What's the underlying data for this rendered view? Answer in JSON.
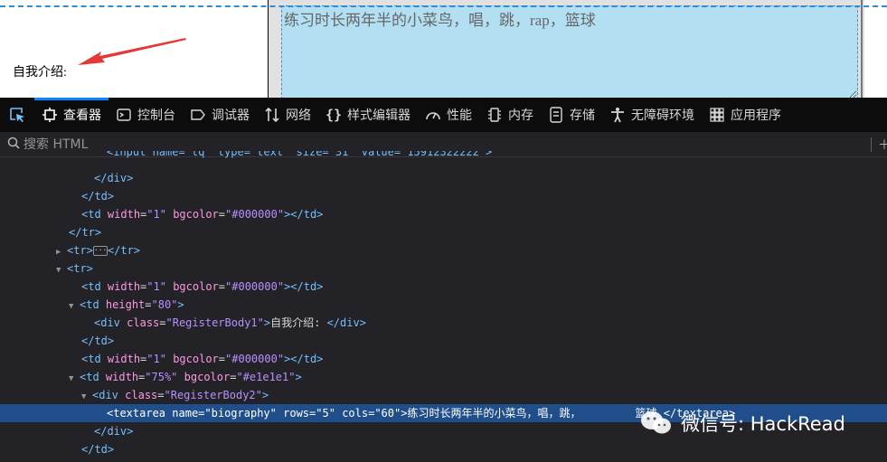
{
  "viewport": {
    "label": "自我介绍:",
    "textarea_value": "练习时长两年半的小菜鸟，唱，跳，rap，篮球"
  },
  "toolbar": {
    "tabs": [
      {
        "label": "查看器",
        "icon": "inspector-icon"
      },
      {
        "label": "控制台",
        "icon": "console-icon"
      },
      {
        "label": "调试器",
        "icon": "debugger-icon"
      },
      {
        "label": "网络",
        "icon": "network-icon"
      },
      {
        "label": "样式编辑器",
        "icon": "style-editor-icon"
      },
      {
        "label": "性能",
        "icon": "performance-icon"
      },
      {
        "label": "内存",
        "icon": "memory-icon"
      },
      {
        "label": "存储",
        "icon": "storage-icon"
      },
      {
        "label": "无障碍环境",
        "icon": "accessibility-icon"
      },
      {
        "label": "应用程序",
        "icon": "application-icon"
      }
    ],
    "active_tab": "查看器"
  },
  "search": {
    "placeholder": "搜索 HTML"
  },
  "tree": {
    "line0": "<input name=\"tq\" type=\"text\" size=\"31\" value=\"15912322222\">",
    "l1_close": "</div>",
    "l2_close": "</td>",
    "l3": {
      "open": "<td",
      "a1": "width",
      "v1": "\"1\"",
      "a2": "bgcolor",
      "v2": "\"#000000\"",
      "close": "></td>"
    },
    "l4_close": "</tr>",
    "l5": {
      "open": "<tr>",
      "close": "</tr>",
      "ellipsis": "···"
    },
    "l6_open": "<tr>",
    "l7": {
      "open": "<td",
      "a1": "width",
      "v1": "\"1\"",
      "a2": "bgcolor",
      "v2": "\"#000000\"",
      "close": "></td>"
    },
    "l8": {
      "open": "<td",
      "a1": "height",
      "v1": "\"80\"",
      "close": ">"
    },
    "l9": {
      "open": "<div",
      "a1": "class",
      "v1": "\"RegisterBody1\"",
      "gt": ">",
      "text": "自我介绍:",
      "close": "</div>"
    },
    "l10_close": "</td>",
    "l11": {
      "open": "<td",
      "a1": "width",
      "v1": "\"1\"",
      "a2": "bgcolor",
      "v2": "\"#000000\"",
      "close": "></td>"
    },
    "l12": {
      "open": "<td",
      "a1": "width",
      "v1": "\"75%\"",
      "a2": "bgcolor",
      "v2": "\"#e1e1e1\"",
      "close": ">"
    },
    "l13": {
      "open": "<div",
      "a1": "class",
      "v1": "\"RegisterBody2\"",
      "close": ">"
    },
    "l14": {
      "open": "<textarea",
      "a1": "name",
      "v1": "\"biography\"",
      "a2": "rows",
      "v2": "\"5\"",
      "a3": "cols",
      "v3": "\"60\"",
      "gt": ">",
      "text": "练习时长两年半的小菜鸟，唱，跳，",
      "text2": "篮球",
      "close": "</textarea>"
    },
    "l15_close": "</div>",
    "l16_close": "</td>"
  },
  "watermark": {
    "text": "微信号: HackRead"
  }
}
